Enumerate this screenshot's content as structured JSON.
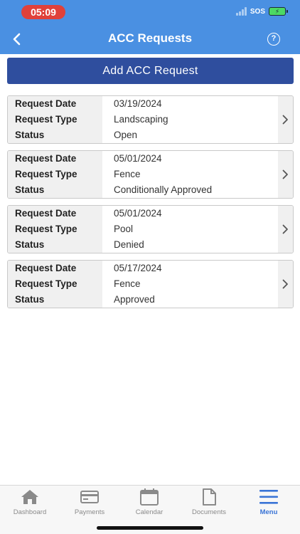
{
  "status_bar": {
    "time": "05:09",
    "carrier": "SOS"
  },
  "header": {
    "title": "ACC Requests",
    "help_glyph": "?"
  },
  "actions": {
    "add_label": "Add ACC Request"
  },
  "labels": {
    "date": "Request Date",
    "type": "Request Type",
    "status": "Status"
  },
  "requests": [
    {
      "date": "03/19/2024",
      "type": "Landscaping",
      "status": "Open"
    },
    {
      "date": "05/01/2024",
      "type": "Fence",
      "status": "Conditionally Approved"
    },
    {
      "date": "05/01/2024",
      "type": "Pool",
      "status": "Denied"
    },
    {
      "date": "05/17/2024",
      "type": "Fence",
      "status": "Approved"
    }
  ],
  "tabs": [
    {
      "label": "Dashboard",
      "icon": "home-icon",
      "active": false
    },
    {
      "label": "Payments",
      "icon": "credit-card-icon",
      "active": false
    },
    {
      "label": "Calendar",
      "icon": "calendar-icon",
      "active": false
    },
    {
      "label": "Documents",
      "icon": "document-icon",
      "active": false
    },
    {
      "label": "Menu",
      "icon": "menu-icon",
      "active": true
    }
  ],
  "colors": {
    "header": "#4a90e2",
    "button": "#2f4e9e",
    "active_tab": "#3a74d6",
    "time_pill": "#e0413a"
  }
}
